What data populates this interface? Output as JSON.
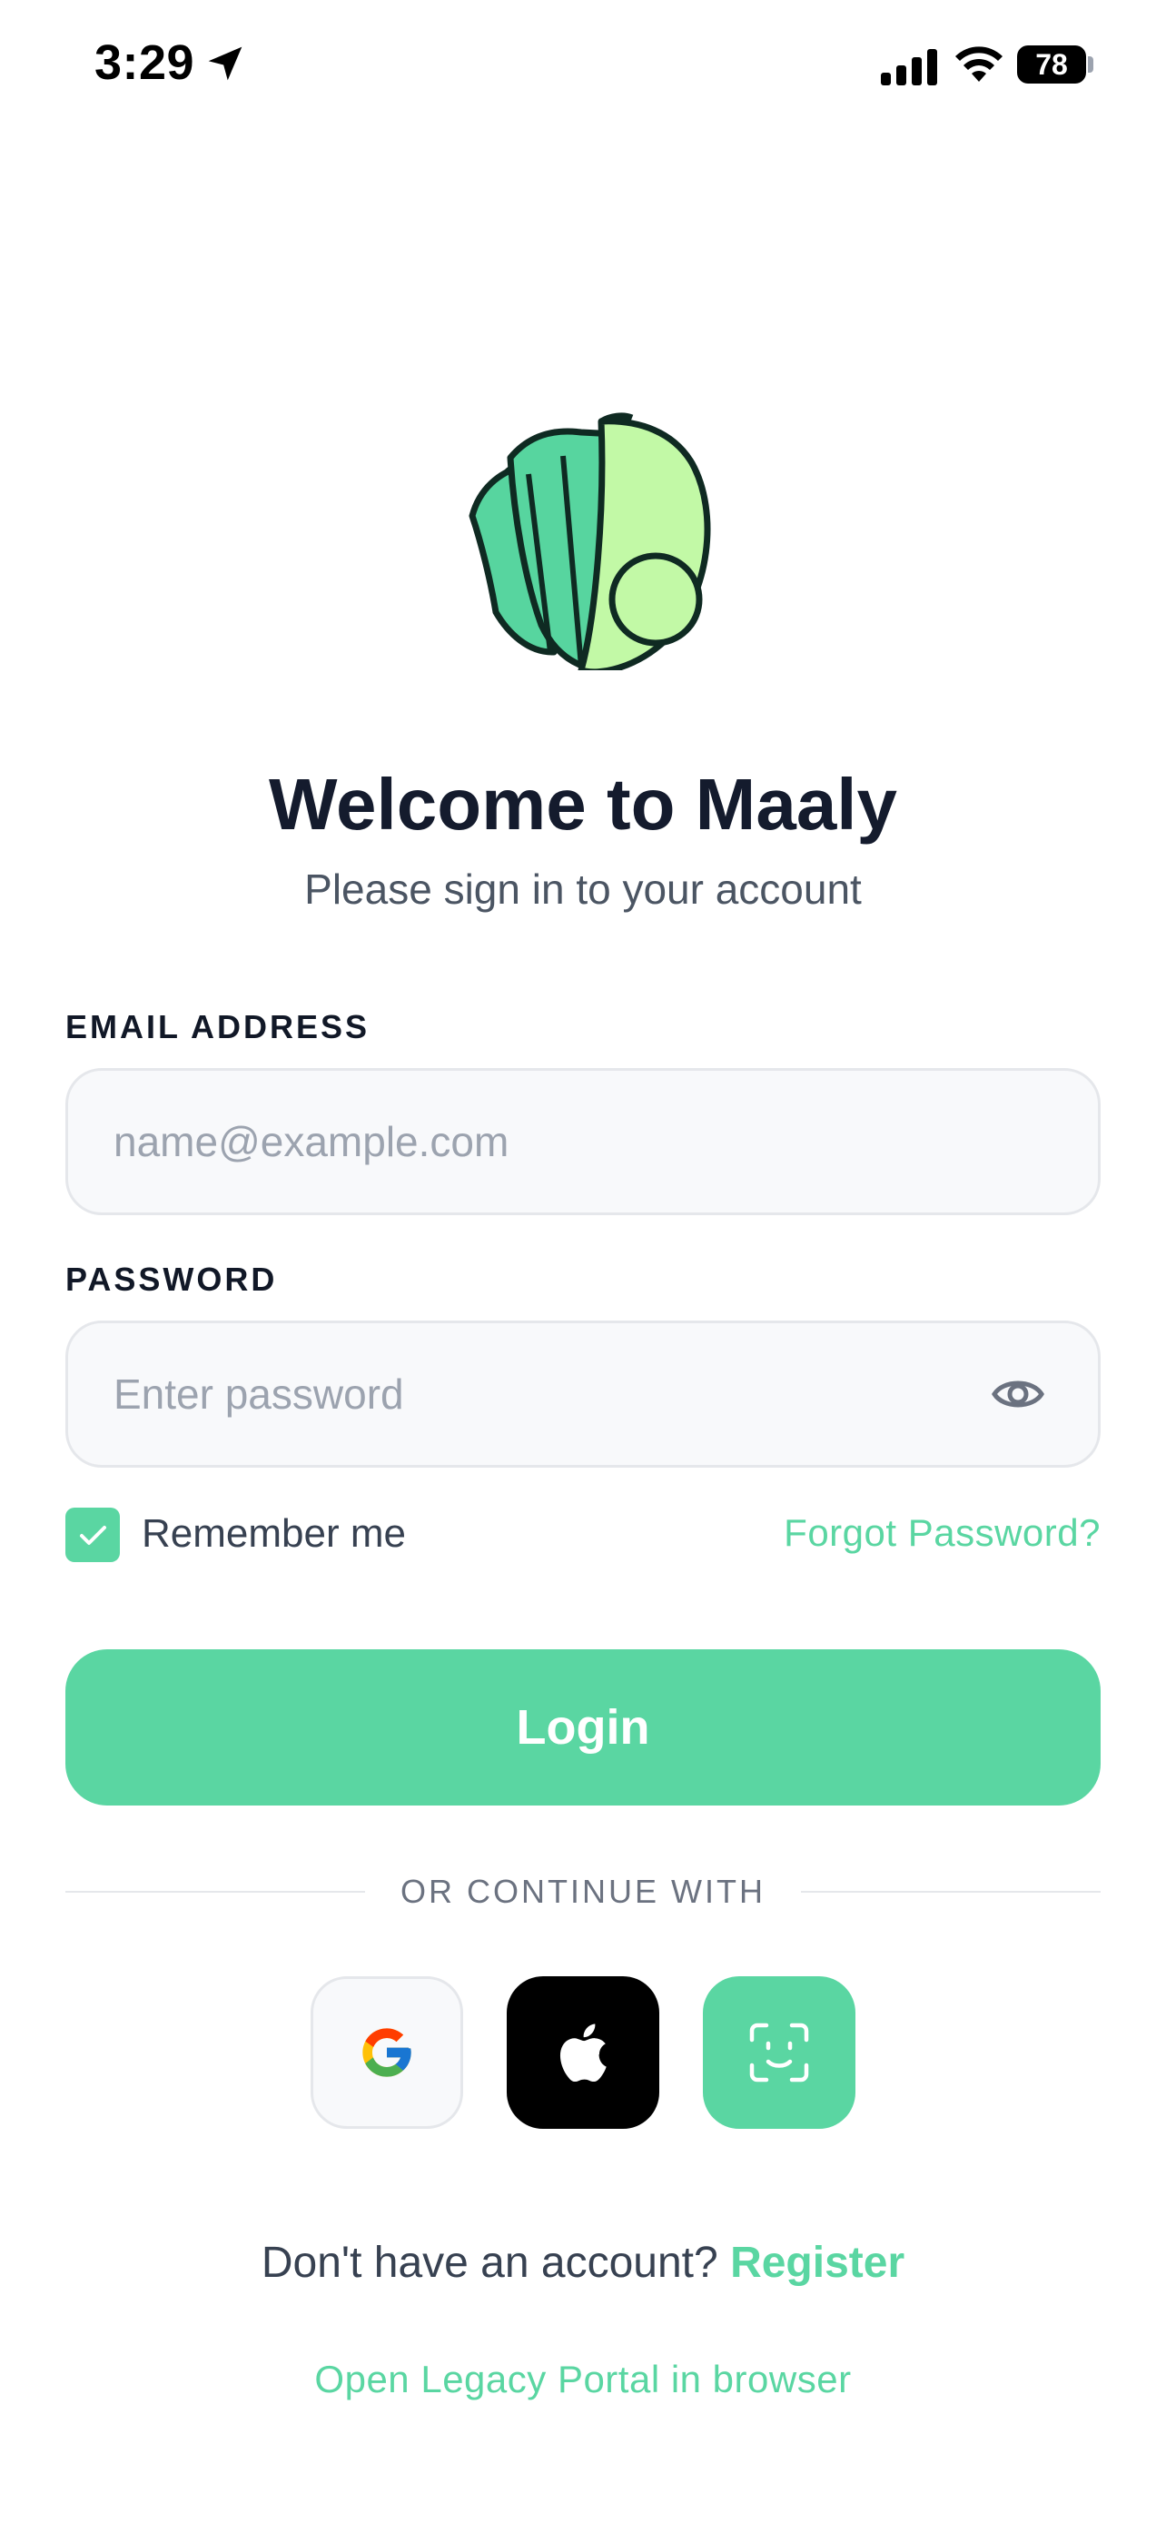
{
  "status_bar": {
    "time": "3:29",
    "battery": "78"
  },
  "app": {
    "title": "Welcome to Maaly",
    "subtitle": "Please sign in to your account"
  },
  "form": {
    "email_label": "EMAIL ADDRESS",
    "email_placeholder": "name@example.com",
    "email_value": "",
    "password_label": "PASSWORD",
    "password_placeholder": "Enter password",
    "password_value": "",
    "remember_label": "Remember me",
    "remember_checked": true,
    "forgot_label": "Forgot Password?",
    "login_label": "Login"
  },
  "divider": {
    "text": "OR CONTINUE WITH"
  },
  "social": [
    "google-icon",
    "apple-icon",
    "face-id-icon"
  ],
  "footer": {
    "register_prompt": "Don't have an account?",
    "register_link": "Register",
    "legacy_link": "Open Legacy Portal in browser"
  },
  "colors": {
    "accent": "#5ad6a2",
    "title": "#141b2d",
    "logo_light": "#c2f9a6",
    "logo_dark": "#57d59f"
  }
}
